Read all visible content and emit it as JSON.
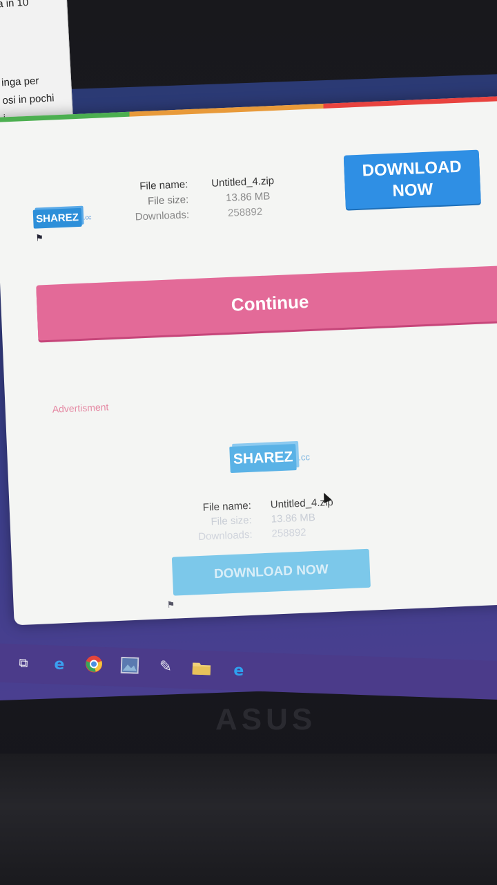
{
  "side_panel": {
    "lines": [
      "a in 10",
      "inga per",
      "osi in pochi",
      "i"
    ]
  },
  "header": {
    "logo": {
      "text": "SHAREZ",
      "suffix": ".cc"
    },
    "info": {
      "file_name_label": "File name:",
      "file_name_value": "Untitled_4.zip",
      "file_size_label": "File size:",
      "file_size_value": "13.86 MB",
      "downloads_label": "Downloads:",
      "downloads_value": "258892"
    },
    "download_button": {
      "line1": "DOWNLOAD",
      "line2": "NOW"
    }
  },
  "continue_button": {
    "label": "Continue"
  },
  "advertisement": {
    "label": "Advertisment",
    "logo": {
      "text": "SHAREZ",
      "suffix": ".cc"
    },
    "info": {
      "file_name_label": "File name:",
      "file_name_value": "Untitled_4.zip",
      "file_size_label": "File size:",
      "file_size_value": "13.86 MB",
      "downloads_label": "Downloads:",
      "downloads_value": "258892"
    },
    "download_button": {
      "label": "DOWNLOAD NOW"
    }
  },
  "colors": {
    "download_blue": "#2f8fe4",
    "continue_pink": "#e36a98",
    "ad_button_blue": "#7cc8ea",
    "ad_label_pink": "#e58aa4",
    "logo_blue": "#2d8fd9"
  },
  "taskbar": {
    "icons": [
      "task-view-icon",
      "edge-icon",
      "chrome-icon",
      "photo-icon",
      "paint-icon",
      "file-explorer-icon",
      "internet-explorer-icon"
    ]
  },
  "bezel": {
    "brand": "ASUS"
  }
}
